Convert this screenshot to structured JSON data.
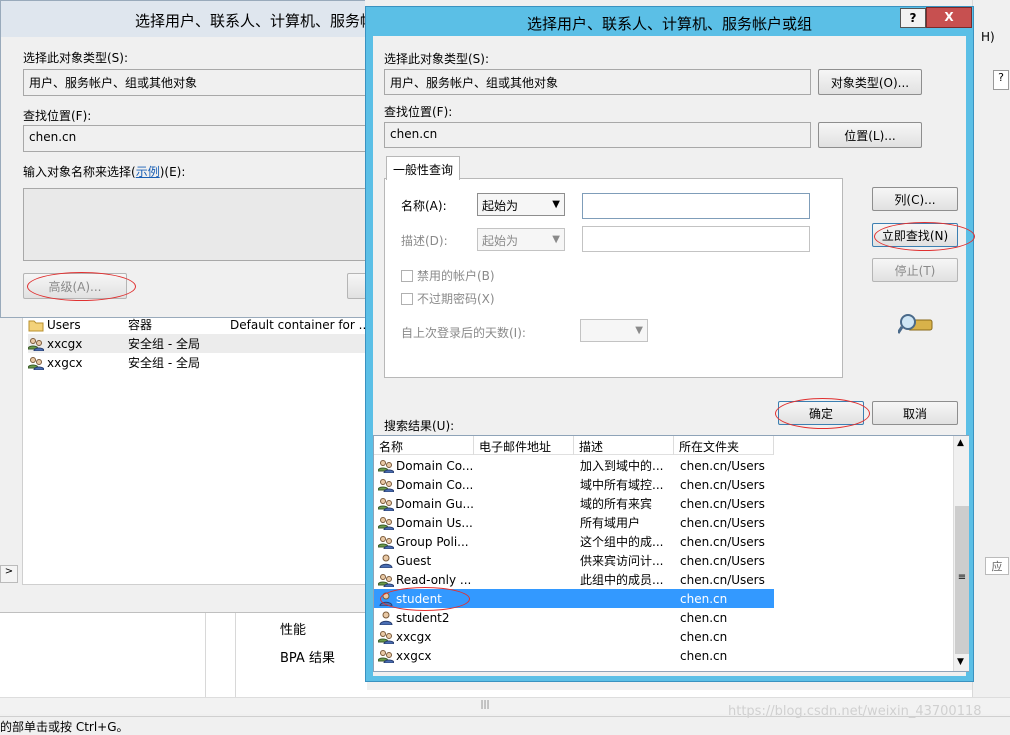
{
  "background": {
    "list_rows": [
      {
        "name": "Users",
        "type": "容器",
        "desc": "Default container for ...",
        "icon": "folder-icon"
      },
      {
        "name": "xxcgx",
        "type": "安全组 - 全局",
        "desc": "",
        "icon": "group-icon"
      },
      {
        "name": "xxgcx",
        "type": "安全组 - 全局",
        "desc": "",
        "icon": "group-icon"
      }
    ],
    "bottom_items": [
      "性能",
      "BPA 结果"
    ],
    "statusbar_text": "的部单击或按 Ctrl+G。",
    "watermark": "https://blog.csdn.net/weixin_43700118",
    "right_strip": {
      "fragment_top": "H)",
      "fragment_mid": "应",
      "help_symbol": "?"
    }
  },
  "behind_dialog": {
    "title": "选择用户、联系人、计算机、服务帐",
    "object_type_label": "选择此对象类型(S):",
    "object_type_value": "用户、服务帐户、组或其他对象",
    "location_label": "查找位置(F):",
    "location_value": "chen.cn",
    "enter_names_label_pre": "输入对象名称来选择(",
    "enter_names_link": "示例",
    "enter_names_label_post": ")(E):",
    "advanced_button": "高级(A)..."
  },
  "dialog": {
    "title": "选择用户、联系人、计算机、服务帐户或组",
    "help_button": "?",
    "close_button": "X",
    "object_type_label": "选择此对象类型(S):",
    "object_type_value": "用户、服务帐户、组或其他对象",
    "object_type_button": "对象类型(O)...",
    "location_label": "查找位置(F):",
    "location_value": "chen.cn",
    "location_button": "位置(L)...",
    "tab_label": "一般性查询",
    "name_label": "名称(A):",
    "name_operator": "起始为",
    "name_value": "",
    "desc_label": "描述(D):",
    "desc_operator": "起始为",
    "desc_value": "",
    "disabled_accounts": "禁用的帐户(B)",
    "non_expiring_pwd": "不过期密码(X)",
    "days_since_logon": "自上次登录后的天数(I):",
    "days_value": "",
    "columns_button": "列(C)...",
    "find_now_button": "立即查找(N)",
    "stop_button": "停止(T)",
    "search_results_label": "搜索结果(U):",
    "ok_button": "确定",
    "cancel_button": "取消",
    "results_columns": [
      "名称",
      "电子邮件地址",
      "描述",
      "所在文件夹"
    ],
    "results": [
      {
        "name": "Domain Co...",
        "email": "",
        "desc": "加入到域中的...",
        "folder": "chen.cn/Users",
        "icon": "group-icon"
      },
      {
        "name": "Domain Co...",
        "email": "",
        "desc": "域中所有域控...",
        "folder": "chen.cn/Users",
        "icon": "group-icon"
      },
      {
        "name": "Domain Gu...",
        "email": "",
        "desc": "域的所有来宾",
        "folder": "chen.cn/Users",
        "icon": "group-icon"
      },
      {
        "name": "Domain Us...",
        "email": "",
        "desc": "所有域用户",
        "folder": "chen.cn/Users",
        "icon": "group-icon"
      },
      {
        "name": "Group Poli...",
        "email": "",
        "desc": "这个组中的成...",
        "folder": "chen.cn/Users",
        "icon": "group-icon"
      },
      {
        "name": "Guest",
        "email": "",
        "desc": "供来宾访问计...",
        "folder": "chen.cn/Users",
        "icon": "user-icon"
      },
      {
        "name": "Read-only ...",
        "email": "",
        "desc": "此组中的成员...",
        "folder": "chen.cn/Users",
        "icon": "group-icon"
      },
      {
        "name": "student",
        "email": "",
        "desc": "",
        "folder": "chen.cn",
        "icon": "user-icon",
        "selected": true
      },
      {
        "name": "student2",
        "email": "",
        "desc": "",
        "folder": "chen.cn",
        "icon": "user-icon"
      },
      {
        "name": "xxcgx",
        "email": "",
        "desc": "",
        "folder": "chen.cn",
        "icon": "group-icon"
      },
      {
        "name": "xxgcx",
        "email": "",
        "desc": "",
        "folder": "chen.cn",
        "icon": "group-icon"
      }
    ]
  },
  "colors": {
    "title_bar": "#5bbfe6",
    "selection": "#3399ff",
    "annotation": "#e03030",
    "close_button": "#c75050"
  }
}
